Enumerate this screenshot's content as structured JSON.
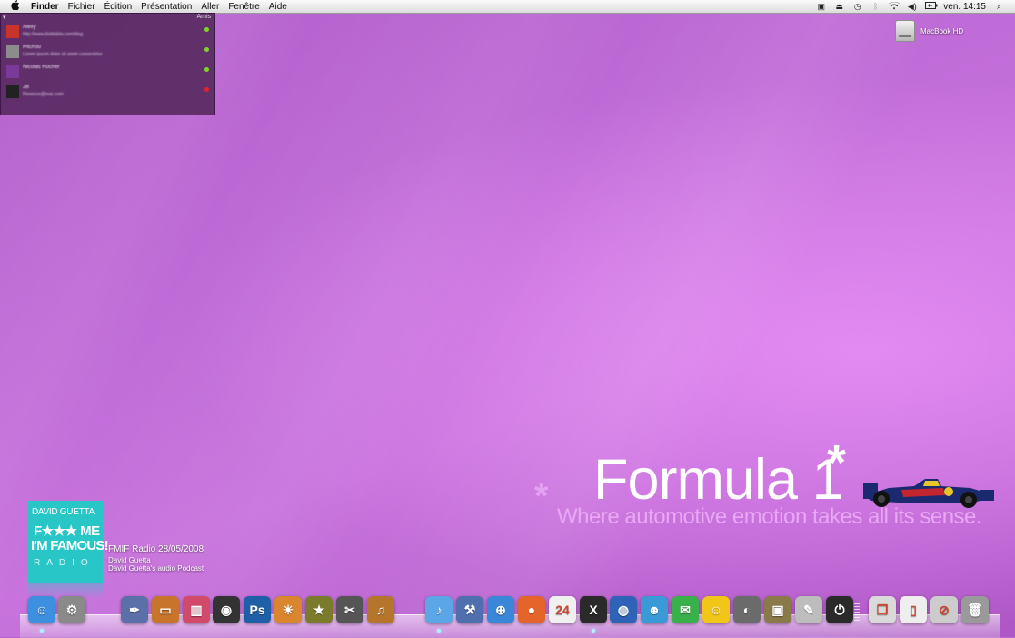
{
  "menubar": {
    "apple": "",
    "items": [
      "Finder",
      "Fichier",
      "Édition",
      "Présentation",
      "Aller",
      "Fenêtre",
      "Aide"
    ],
    "status_icons": [
      "screen-icon",
      "sync-icon",
      "time-machine-icon",
      "bluetooth-icon",
      "wifi-icon",
      "volume-icon",
      "battery-icon"
    ],
    "clock": "ven. 14:15",
    "spotlight": "⌕"
  },
  "friends": {
    "title": "Amis",
    "list": [
      {
        "name": "Alexy",
        "status": "http://www.blablabla.com/blog",
        "dot": "#7fd32a",
        "avatar": "#c8342a"
      },
      {
        "name": "Pitchou",
        "status": "Lorem ipsum dolor sit amet consectetur",
        "dot": "#7fd32a",
        "avatar": "#8c8c8c"
      },
      {
        "name": "Nicolas Rocher",
        "status": "",
        "dot": "#7fd32a",
        "avatar": "#7a3a9a"
      },
      {
        "name": "JB",
        "status": "Florence@mac.com",
        "dot": "#e0252a",
        "avatar": "#222222"
      }
    ]
  },
  "desktop": {
    "drive_label": "MacBook HD"
  },
  "wallpaper": {
    "title": "Formula 1",
    "star": "*",
    "tagline": "Where automotive emotion takes all its sense."
  },
  "podcast": {
    "cover_line1": "DAVID GUETTA",
    "cover_line2": "F★★★ ME",
    "cover_line3": "I'M FAMOUS!",
    "cover_line4": "RADIO",
    "title": "FMIF Radio 28/05/2008",
    "artist": "David Guetta",
    "subtitle": "David Guetta's audio Podcast"
  },
  "dock": {
    "apps": [
      {
        "name": "finder-icon",
        "glyph": "☺",
        "color": "#3d8fe0",
        "running": true
      },
      {
        "name": "system-preferences-icon",
        "glyph": "⚙",
        "color": "#8a8a8a",
        "running": false
      },
      {
        "name": "pen-tool-icon",
        "glyph": "✒",
        "color": "#5b6fa8",
        "running": false
      },
      {
        "name": "keynote-icon",
        "glyph": "▭",
        "color": "#c8742a",
        "running": false
      },
      {
        "name": "charts-app-icon",
        "glyph": "▥",
        "color": "#d24a6a",
        "running": false
      },
      {
        "name": "aperture-icon",
        "glyph": "◉",
        "color": "#333333",
        "running": false
      },
      {
        "name": "photoshop-icon",
        "glyph": "Ps",
        "color": "#1f5fa8",
        "running": false
      },
      {
        "name": "iphoto-icon",
        "glyph": "☀",
        "color": "#d9862f",
        "running": false
      },
      {
        "name": "imovie-icon",
        "glyph": "★",
        "color": "#7b7b2c",
        "running": false
      },
      {
        "name": "final-cut-icon",
        "glyph": "✂",
        "color": "#555555",
        "running": false
      },
      {
        "name": "garageband-icon",
        "glyph": "♫",
        "color": "#b5762c",
        "running": false
      },
      {
        "name": "itunes-icon",
        "glyph": "♪",
        "color": "#5aa6e6",
        "running": true
      },
      {
        "name": "xcode-icon",
        "glyph": "⚒",
        "color": "#4f6fae",
        "running": false
      },
      {
        "name": "safari-icon",
        "glyph": "⊕",
        "color": "#3a86d8",
        "running": false
      },
      {
        "name": "firefox-icon",
        "glyph": "●",
        "color": "#e4642a",
        "running": false
      },
      {
        "name": "ical-icon",
        "glyph": "24",
        "color": "#f0f0f0",
        "running": false
      },
      {
        "name": "mac-os-x-icon",
        "glyph": "X",
        "color": "#2a2a2a",
        "running": true
      },
      {
        "name": "google-earth-icon",
        "glyph": "◍",
        "color": "#2e63b8",
        "running": false
      },
      {
        "name": "messenger-icon",
        "glyph": "☻",
        "color": "#3a9ad8",
        "running": false
      },
      {
        "name": "ichat-icon",
        "glyph": "✉",
        "color": "#39b14a",
        "running": false
      },
      {
        "name": "yahoo-messenger-icon",
        "glyph": "☺",
        "color": "#f2c619",
        "running": false
      },
      {
        "name": "disk-utility-icon",
        "glyph": "◐",
        "color": "#6b6b6b",
        "running": false
      },
      {
        "name": "preview-icon",
        "glyph": "▣",
        "color": "#8a7a4a",
        "running": false
      },
      {
        "name": "text-editor-icon",
        "glyph": "✎",
        "color": "#bdbdbd",
        "running": false
      },
      {
        "name": "power-icon",
        "glyph": "⏻",
        "color": "#2a2a2a",
        "running": false
      }
    ],
    "stacks": [
      {
        "name": "documents-stack-icon",
        "glyph": "❐",
        "color": "#d9d9d9"
      },
      {
        "name": "file-icon",
        "glyph": "▯",
        "color": "#eeeeee"
      },
      {
        "name": "no-entry-icon",
        "glyph": "⊘",
        "color": "#cccccc"
      },
      {
        "name": "trash-icon",
        "glyph": "🗑",
        "color": "#9a9a9a"
      }
    ]
  }
}
